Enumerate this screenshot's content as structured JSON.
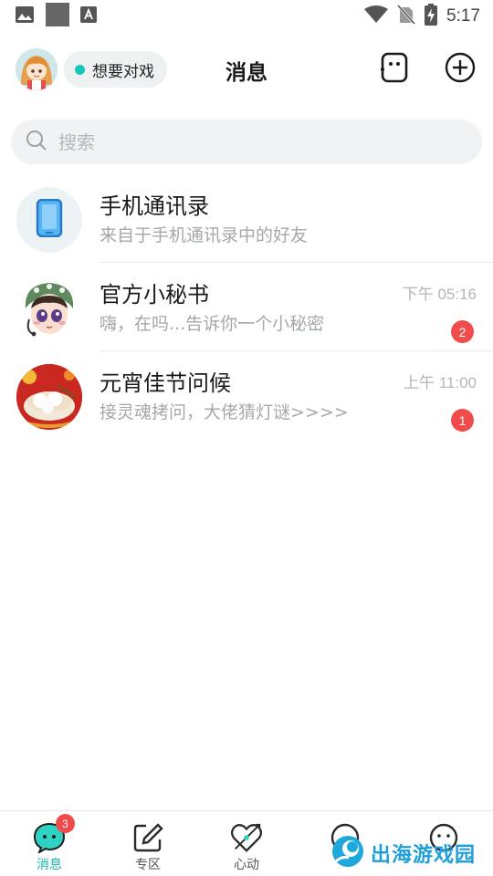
{
  "status_bar": {
    "time": "5:17",
    "icons": [
      "image-icon",
      "square-icon",
      "text-icon",
      "wifi-icon",
      "no-sim-icon",
      "battery-charging-icon"
    ]
  },
  "header": {
    "title": "消息",
    "status_label": "想要对戏",
    "status_color": "#17c6b4",
    "icons": [
      "profile-avatar",
      "contacts-book-icon",
      "add-circle-icon"
    ]
  },
  "search": {
    "placeholder": "搜索"
  },
  "conversations": [
    {
      "name": "手机通讯录",
      "preview": "来自于手机通讯录中的好友",
      "time": "",
      "unread": ""
    },
    {
      "name": "官方小秘书",
      "preview": "嗨，在吗...告诉你一个小秘密",
      "time": "下午 05:16",
      "unread": "2"
    },
    {
      "name": "元宵佳节问候",
      "preview": "接灵魂拷问，大佬猜灯谜>>>>",
      "time": "上午 11:00",
      "unread": "1"
    }
  ],
  "bottom_nav": {
    "accent_color": "#17b9aa",
    "items": [
      {
        "label": "消息",
        "icon": "message-bubble-icon",
        "badge": "3",
        "active": true
      },
      {
        "label": "专区",
        "icon": "edit-square-icon",
        "badge": "",
        "active": false
      },
      {
        "label": "心动",
        "icon": "heart-arrow-icon",
        "badge": "",
        "active": false
      },
      {
        "label": "",
        "icon": "discover-icon",
        "badge": "",
        "active": false
      },
      {
        "label": "",
        "icon": "profile-icon",
        "badge": "",
        "active": false
      }
    ]
  },
  "watermark": {
    "text": "出海游戏园"
  }
}
